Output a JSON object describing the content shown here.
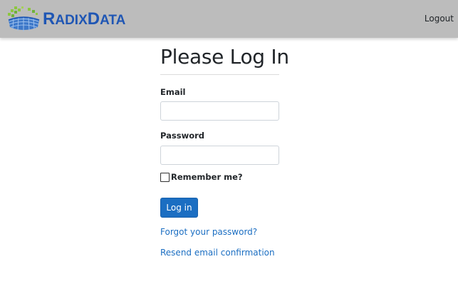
{
  "header": {
    "brand_big_1": "R",
    "brand_small_1": "ADIX",
    "brand_big_2": "D",
    "brand_small_2": "ATA",
    "logout_label": "Logout",
    "brand_color": "#1f56b4",
    "background_color": "#bcbcbc"
  },
  "login": {
    "title": "Please Log In",
    "email_label": "Email",
    "email_value": "",
    "password_label": "Password",
    "password_value": "",
    "remember_label": "Remember me?",
    "remember_checked": false,
    "submit_label": "Log in",
    "forgot_link": "Forgot your password?",
    "resend_link": "Resend email confirmation",
    "accent_color": "#1b6ec2"
  },
  "icons": {
    "logo": "radixdata-globe-logo-icon"
  }
}
